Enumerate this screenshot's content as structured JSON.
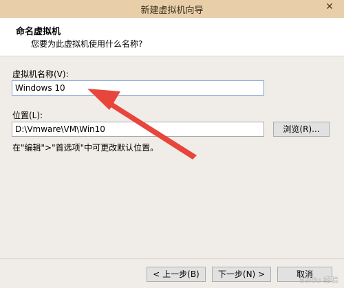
{
  "window": {
    "title": "新建虚拟机向导",
    "close_symbol": "✕"
  },
  "header": {
    "title": "命名虚拟机",
    "subtitle": "您要为此虚拟机使用什么名称?"
  },
  "vm_name": {
    "label": "虚拟机名称(V):",
    "value": "Windows 10"
  },
  "location": {
    "label": "位置(L):",
    "value": "D:\\Vmware\\VM\\Win10",
    "browse_label": "浏览(R)..."
  },
  "hint": "在\"编辑\">\"首选项\"中可更改默认位置。",
  "footer": {
    "back_label": "< 上一步(B)",
    "next_label": "下一步(N) >",
    "cancel_label": "取消"
  },
  "watermark": "Baidu 经验",
  "colors": {
    "arrow": "#e8453c",
    "titlebar": "#e9cfa9"
  }
}
